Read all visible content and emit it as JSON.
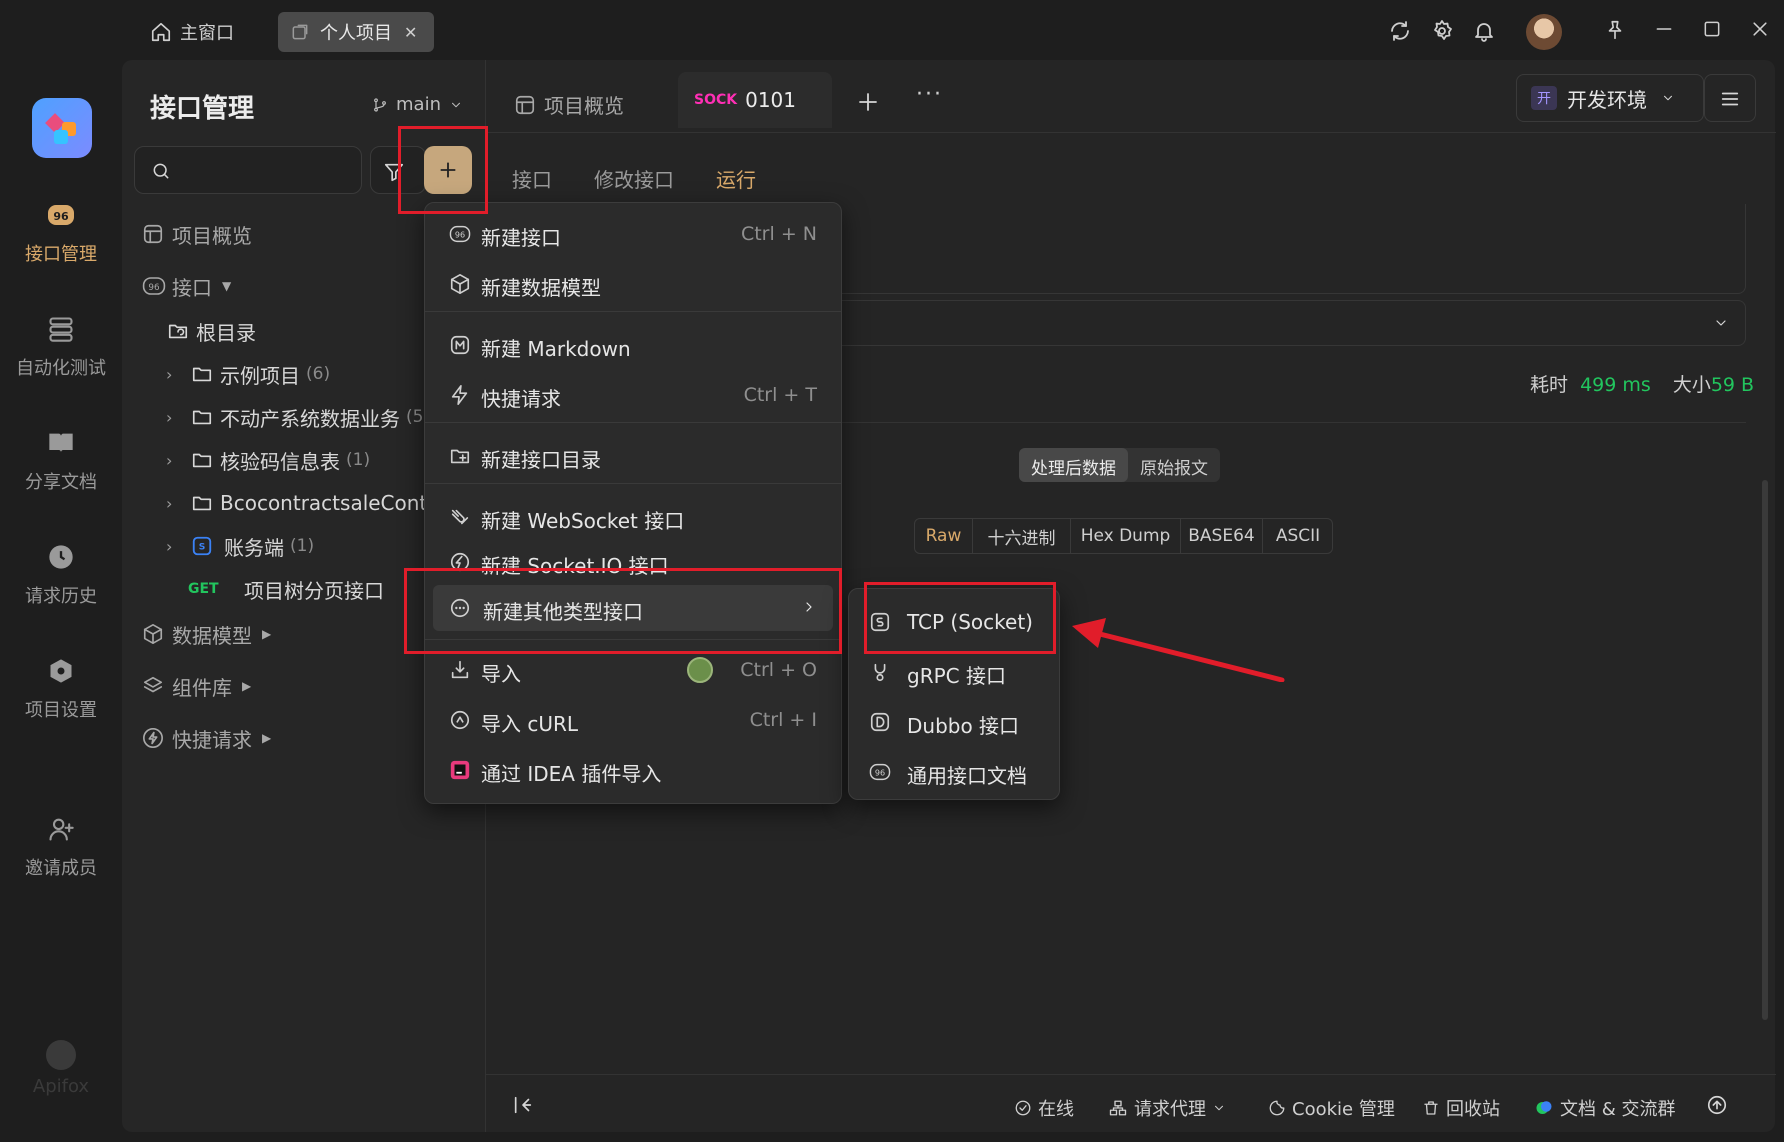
{
  "titlebar": {
    "home_tab": "主窗口",
    "project_tab": "个人项目",
    "close_glyph": "✕"
  },
  "rail": {
    "items": [
      {
        "label": "接口管理",
        "icon": "api-icon"
      },
      {
        "label": "自动化测试",
        "icon": "stack-icon"
      },
      {
        "label": "分享文档",
        "icon": "book-icon"
      },
      {
        "label": "请求历史",
        "icon": "clock-icon"
      },
      {
        "label": "项目设置",
        "icon": "hexagon-settings-icon"
      },
      {
        "label": "邀请成员",
        "icon": "user-plus-icon"
      }
    ],
    "brand": "Apifox"
  },
  "sidebar": {
    "title": "接口管理",
    "branch": "main",
    "overview": "项目概览",
    "apis": "接口",
    "root": "根目录",
    "folders": [
      {
        "name": "示例项目",
        "count": "(6)"
      },
      {
        "name": "不动产系统数据业务",
        "count": "(5"
      },
      {
        "name": "核验码信息表",
        "count": "(1)"
      },
      {
        "name": "BcocontractsaleContr..",
        "count": ""
      },
      {
        "name": "账务端",
        "count": "(1)"
      }
    ],
    "get_method": "GET",
    "get_item": "项目树分页接口",
    "data_models": "数据模型",
    "components": "组件库",
    "quick_requests": "快捷请求"
  },
  "main": {
    "tab_overview": "项目概览",
    "sock_badge": "SOCK",
    "sock_name": "0101",
    "env": "开发环境",
    "env_badge": "开",
    "subtabs": [
      "接口",
      "修改接口",
      "运行"
    ],
    "time_label": "耗时",
    "time_value": "499 ms",
    "size_label": "大小",
    "size_value": "59 B",
    "view_tabs": [
      "处理后数据",
      "原始报文"
    ],
    "format_tabs": [
      "Raw",
      "十六进制",
      "Hex Dump",
      "BASE64",
      "ASCII"
    ]
  },
  "menu": {
    "items": [
      {
        "label": "新建接口",
        "shortcut": "Ctrl + N"
      },
      {
        "label": "新建数据模型",
        "shortcut": ""
      },
      {
        "label": "新建 Markdown",
        "shortcut": ""
      },
      {
        "label": "快捷请求",
        "shortcut": "Ctrl + T"
      },
      {
        "label": "新建接口目录",
        "shortcut": ""
      },
      {
        "label": "新建 WebSocket 接口",
        "shortcut": ""
      },
      {
        "label": "新建 Socket.IO 接口",
        "shortcut": ""
      },
      {
        "label": "新建其他类型接口",
        "shortcut": ""
      },
      {
        "label": "导入",
        "shortcut": "Ctrl + O"
      },
      {
        "label": "导入 cURL",
        "shortcut": "Ctrl + I"
      },
      {
        "label": "通过 IDEA 插件导入",
        "shortcut": ""
      }
    ]
  },
  "submenu": {
    "items": [
      "TCP (Socket)",
      "gRPC 接口",
      "Dubbo 接口",
      "通用接口文档"
    ]
  },
  "statusbar": {
    "online": "在线",
    "proxy": "请求代理",
    "cookie": "Cookie 管理",
    "trash": "回收站",
    "docs": "文档 & 交流群"
  },
  "colors": {
    "accent": "#d9a96a",
    "sock_pink": "#ff2fb5",
    "get_green": "#22c55e",
    "highlight_red": "#e11d2a"
  }
}
